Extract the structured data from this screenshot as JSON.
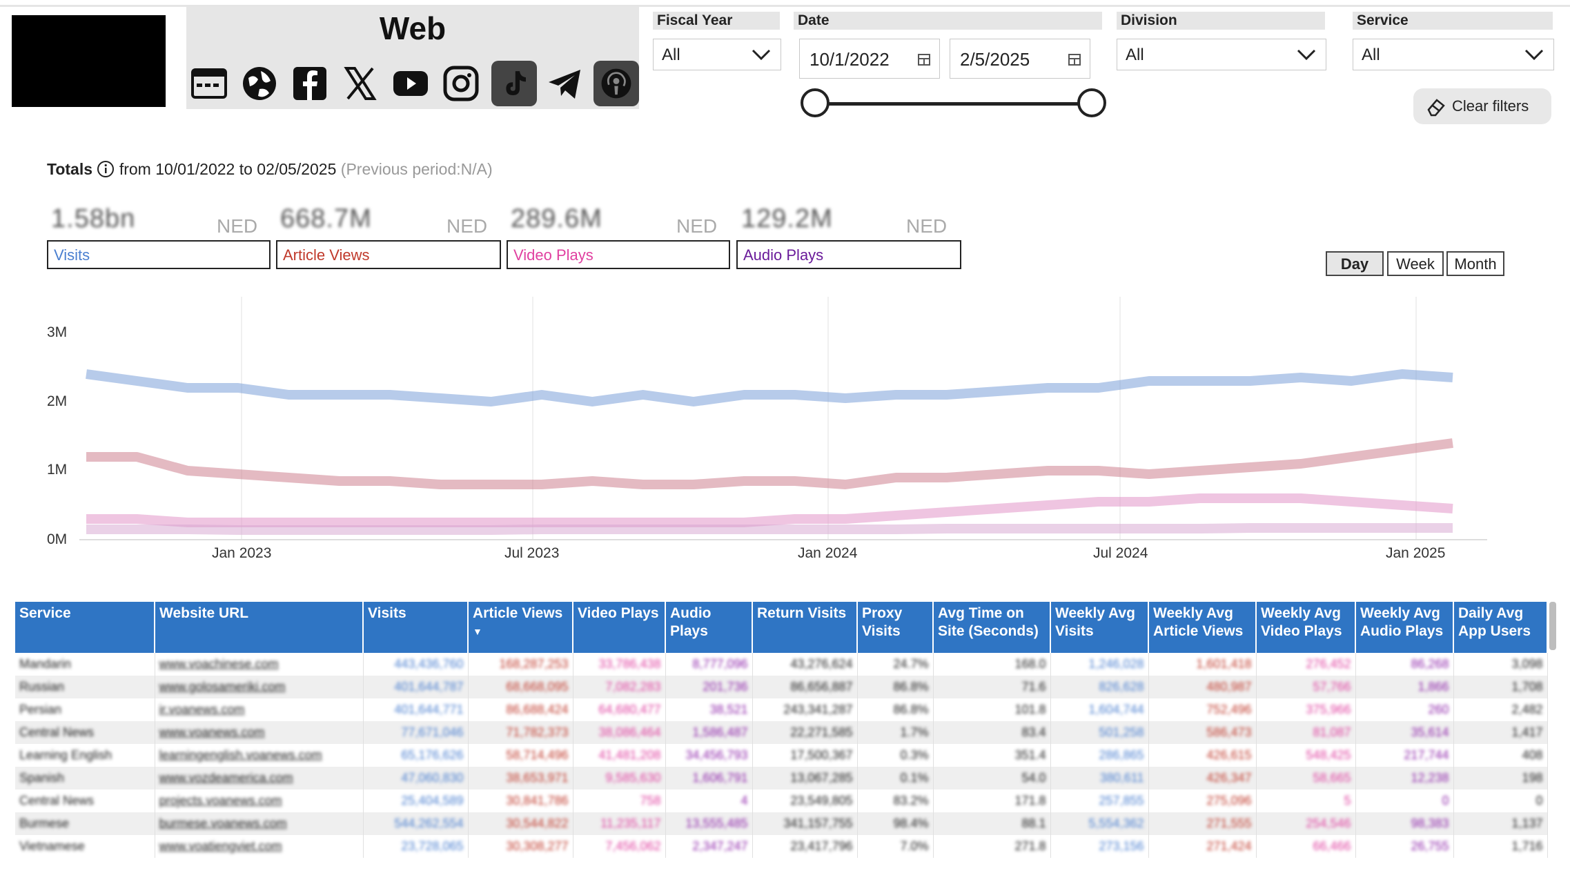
{
  "header": {
    "title": "Web",
    "icons": [
      "web-browser-icon",
      "globe-icon",
      "facebook-icon",
      "x-icon",
      "youtube-icon",
      "instagram-icon",
      "tiktok-icon",
      "telegram-icon",
      "podcast-icon"
    ]
  },
  "filters": {
    "fiscal_year": {
      "label": "Fiscal Year",
      "value": "All"
    },
    "date": {
      "label": "Date",
      "start": "10/1/2022",
      "end": "2/5/2025"
    },
    "division": {
      "label": "Division",
      "value": "All"
    },
    "service": {
      "label": "Service",
      "value": "All"
    },
    "clear_label": "Clear filters"
  },
  "totals": {
    "label": "Totals",
    "range": "from 10/01/2022 to 02/05/2025",
    "previous": "(Previous period:N/A)"
  },
  "kpis": [
    {
      "value": "1.58bn",
      "unit": "NED",
      "label": "Visits",
      "color": "#4a7fd0"
    },
    {
      "value": "668.7M",
      "unit": "NED",
      "label": "Article Views",
      "color": "#c0392b"
    },
    {
      "value": "289.6M",
      "unit": "NED",
      "label": "Video Plays",
      "color": "#e040a0"
    },
    {
      "value": "129.2M",
      "unit": "NED",
      "label": "Audio Plays",
      "color": "#6a1b9a"
    }
  ],
  "granularity": {
    "options": [
      "Day",
      "Week",
      "Month"
    ],
    "selected": "Day"
  },
  "chart_data": {
    "type": "line",
    "ylabel_ticks": [
      "0M",
      "1M",
      "2M",
      "3M"
    ],
    "ylim": [
      0,
      3
    ],
    "x_ticks": [
      "Jan 2023",
      "Jul 2023",
      "Jan 2024",
      "Jul 2024",
      "Jan 2025"
    ],
    "series": [
      {
        "name": "Visits",
        "color": "#6f97d6",
        "values": [
          2.4,
          2.3,
          2.2,
          2.2,
          2.1,
          2.1,
          2.1,
          2.05,
          2.0,
          2.1,
          2.0,
          2.1,
          2.0,
          2.1,
          2.1,
          2.05,
          2.1,
          2.1,
          2.15,
          2.2,
          2.2,
          2.3,
          2.3,
          2.3,
          2.35,
          2.3,
          2.4,
          2.35
        ]
      },
      {
        "name": "Article Views",
        "color": "#c97586",
        "values": [
          1.2,
          1.2,
          1.0,
          0.95,
          0.9,
          0.85,
          0.85,
          0.8,
          0.8,
          0.8,
          0.85,
          0.8,
          0.8,
          0.85,
          0.85,
          0.8,
          0.9,
          0.9,
          0.95,
          1.0,
          1.0,
          0.95,
          1.0,
          1.05,
          1.1,
          1.2,
          1.3,
          1.4
        ]
      },
      {
        "name": "Video Plays",
        "color": "#e08cc4",
        "values": [
          0.3,
          0.3,
          0.25,
          0.25,
          0.25,
          0.25,
          0.25,
          0.25,
          0.25,
          0.25,
          0.25,
          0.25,
          0.25,
          0.25,
          0.3,
          0.3,
          0.35,
          0.4,
          0.45,
          0.5,
          0.55,
          0.55,
          0.6,
          0.6,
          0.6,
          0.55,
          0.5,
          0.45
        ]
      },
      {
        "name": "Audio Plays",
        "color": "#d6a3cf",
        "values": [
          0.15,
          0.15,
          0.15,
          0.14,
          0.14,
          0.14,
          0.14,
          0.14,
          0.14,
          0.15,
          0.15,
          0.15,
          0.15,
          0.15,
          0.15,
          0.15,
          0.15,
          0.16,
          0.16,
          0.16,
          0.16,
          0.16,
          0.16,
          0.17,
          0.17,
          0.17,
          0.17,
          0.17
        ]
      }
    ]
  },
  "table": {
    "columns": [
      "Service",
      "Website URL",
      "Visits",
      "Article Views",
      "Video Plays",
      "Audio Plays",
      "Return Visits",
      "Proxy Visits",
      "Avg Time on Site (Seconds)",
      "Weekly Avg Visits",
      "Weekly Avg Article Views",
      "Weekly Avg Video Plays",
      "Weekly Avg Audio Plays",
      "Daily Avg App Users"
    ],
    "rows": [
      [
        "Mandarin",
        "www.voachinese.com",
        "443,436,760",
        "168,287,253",
        "33,786,438",
        "8,777,096",
        "43,276,624",
        "24.7%",
        "168.0",
        "1,246,028",
        "1,601,418",
        "276,452",
        "86,268",
        "3,098"
      ],
      [
        "Russian",
        "www.golosameriki.com",
        "401,644,787",
        "68,668,095",
        "7,082,283",
        "201,736",
        "86,656,887",
        "86.8%",
        "71.6",
        "826,628",
        "480,987",
        "57,766",
        "1,866",
        "1,708"
      ],
      [
        "Persian",
        "ir.voanews.com",
        "401,644,771",
        "86,688,424",
        "64,680,477",
        "38,521",
        "243,341,287",
        "86.8%",
        "101.8",
        "1,604,744",
        "752,496",
        "375,966",
        "260",
        "2,482"
      ],
      [
        "Central News",
        "www.voanews.com",
        "77,671,046",
        "71,782,373",
        "38,086,464",
        "1,586,487",
        "22,271,585",
        "1.7%",
        "83.4",
        "501,258",
        "586,473",
        "81,087",
        "35,614",
        "1,417"
      ],
      [
        "Learning English",
        "learningenglish.voanews.com",
        "65,176,626",
        "58,714,496",
        "41,481,208",
        "34,456,793",
        "17,500,367",
        "0.3%",
        "351.4",
        "286,865",
        "426,615",
        "548,425",
        "217,744",
        "408"
      ],
      [
        "Spanish",
        "www.vozdeamerica.com",
        "47,060,830",
        "38,653,971",
        "9,585,630",
        "1,606,791",
        "13,067,285",
        "0.1%",
        "54.0",
        "380,611",
        "426,347",
        "58,665",
        "12,238",
        "198"
      ],
      [
        "Central News",
        "projects.voanews.com",
        "25,404,589",
        "30,841,786",
        "758",
        "4",
        "23,549,805",
        "83.2%",
        "171.8",
        "257,855",
        "275,096",
        "5",
        "0",
        "0"
      ],
      [
        "Burmese",
        "burmese.voanews.com",
        "544,262,554",
        "30,544,822",
        "11,235,117",
        "13,555,485",
        "341,157,755",
        "98.4%",
        "88.1",
        "5,554,362",
        "271,555",
        "254,546",
        "98,383",
        "1,137"
      ],
      [
        "Vietnamese",
        "www.voatiengviet.com",
        "23,728,065",
        "30,308,277",
        "7,456,062",
        "2,347,247",
        "23,417,796",
        "7.0%",
        "271.8",
        "273,156",
        "271,424",
        "66,466",
        "26,755",
        "1,716"
      ]
    ]
  }
}
